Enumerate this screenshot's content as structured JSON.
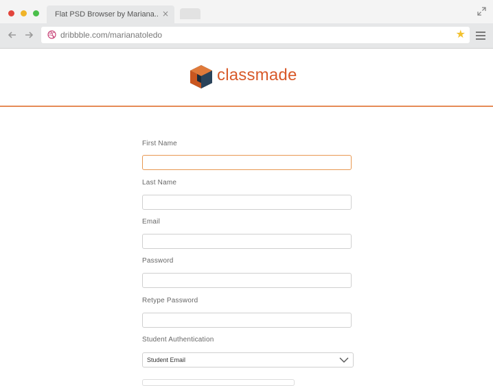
{
  "browser": {
    "tab_title": "Flat  PSD Browser by Mariana..",
    "tab_close": "×",
    "url": "dribbble.com/marianatoledo"
  },
  "brand": {
    "name": "classmade",
    "accent": "#d85a2a",
    "rule_color": "#e58a55"
  },
  "form": {
    "fields": [
      {
        "label": "First Name",
        "value": ""
      },
      {
        "label": "Last Name",
        "value": ""
      },
      {
        "label": "Email",
        "value": ""
      },
      {
        "label": "Password",
        "value": ""
      },
      {
        "label": "Retype Password",
        "value": ""
      }
    ],
    "auth": {
      "label": "Student Authentication",
      "selected": "Student Email"
    }
  },
  "icons": {
    "back": "arrow-left-icon",
    "forward": "arrow-right-icon",
    "site": "dribbble-icon",
    "bookmark": "star-icon",
    "menu": "hamburger-menu-icon",
    "expand": "expand-icon",
    "select": "chevron-down-icon"
  }
}
